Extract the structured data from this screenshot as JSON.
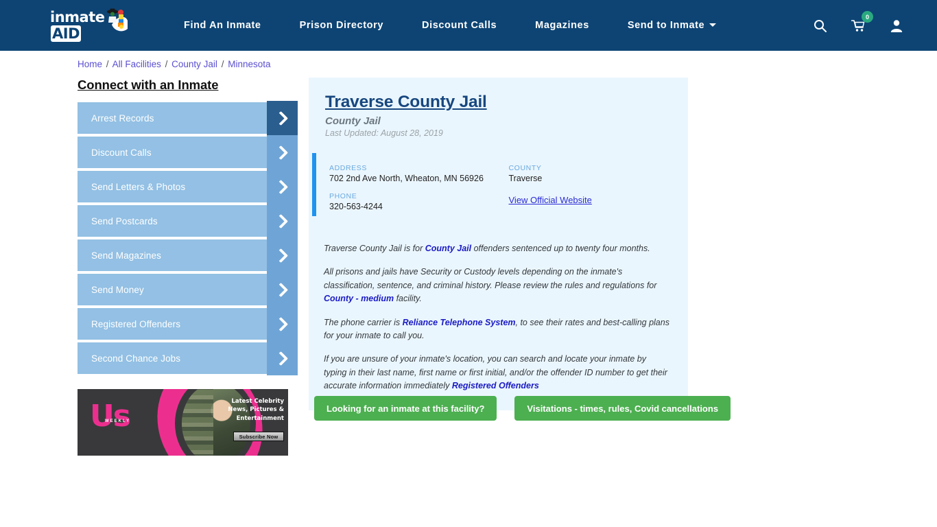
{
  "header": {
    "logo_text": "inmate",
    "logo_accent": "AID",
    "nav": [
      {
        "label": "Find An Inmate",
        "dropdown": false
      },
      {
        "label": "Prison Directory",
        "dropdown": false
      },
      {
        "label": "Discount Calls",
        "dropdown": false
      },
      {
        "label": "Magazines",
        "dropdown": false
      },
      {
        "label": "Send to Inmate",
        "dropdown": true
      }
    ],
    "icons": {
      "search": "search-icon",
      "cart": "cart-icon",
      "cart_count": "0",
      "account": "user-icon"
    },
    "colors": {
      "header_bg": "#0d4474",
      "badge": "#2aa97f"
    }
  },
  "breadcrumb": {
    "items": [
      "Home",
      "All Facilities",
      "County Jail",
      "Minnesota"
    ],
    "separator": "/"
  },
  "sidebar": {
    "title": "Connect with an Inmate",
    "items": [
      {
        "label": "Arrest Records"
      },
      {
        "label": "Discount Calls"
      },
      {
        "label": "Send Letters & Photos"
      },
      {
        "label": "Send Postcards"
      },
      {
        "label": "Send Magazines"
      },
      {
        "label": "Send Money"
      },
      {
        "label": "Registered Offenders"
      },
      {
        "label": "Second Chance Jobs"
      }
    ]
  },
  "ad": {
    "brand": "Us",
    "brand_sub": "WEEKLY",
    "copy": "Latest Celebrity News, Pictures & Entertainment",
    "button": "Subscribe Now"
  },
  "facility": {
    "name": "Traverse County Jail",
    "type": "County Jail",
    "last_updated": "Last Updated: August 28, 2019",
    "address_label": "ADDRESS",
    "address": "702 2nd Ave North, Wheaton, MN 56926",
    "phone_label": "PHONE",
    "phone": "320-563-4244",
    "county_label": "COUNTY",
    "county": "Traverse",
    "website_link": "View Official Website"
  },
  "description": {
    "p1_a": "Traverse County Jail is for ",
    "p1_link": "County Jail",
    "p1_b": " offenders sentenced up to twenty four months.",
    "p2_a": "All prisons and jails have Security or Custody levels depending on the inmate's classification, sentence, and criminal history. Please review the rules and regulations for ",
    "p2_link": "County - medium",
    "p2_b": " facility.",
    "p3_a": "The phone carrier is ",
    "p3_link": "Reliance Telephone System",
    "p3_b": ", to see their rates and best-calling plans for your inmate to call you.",
    "p4_a": "If you are unsure of your inmate's location, you can search and locate your inmate by typing in their last name, first name or first initial, and/or the offender ID number to get their accurate information immediately ",
    "p4_link": "Registered Offenders"
  },
  "cta": {
    "primary": "Looking for an inmate at this facility?",
    "secondary": "Visitations - times, rules, Covid cancellations"
  }
}
